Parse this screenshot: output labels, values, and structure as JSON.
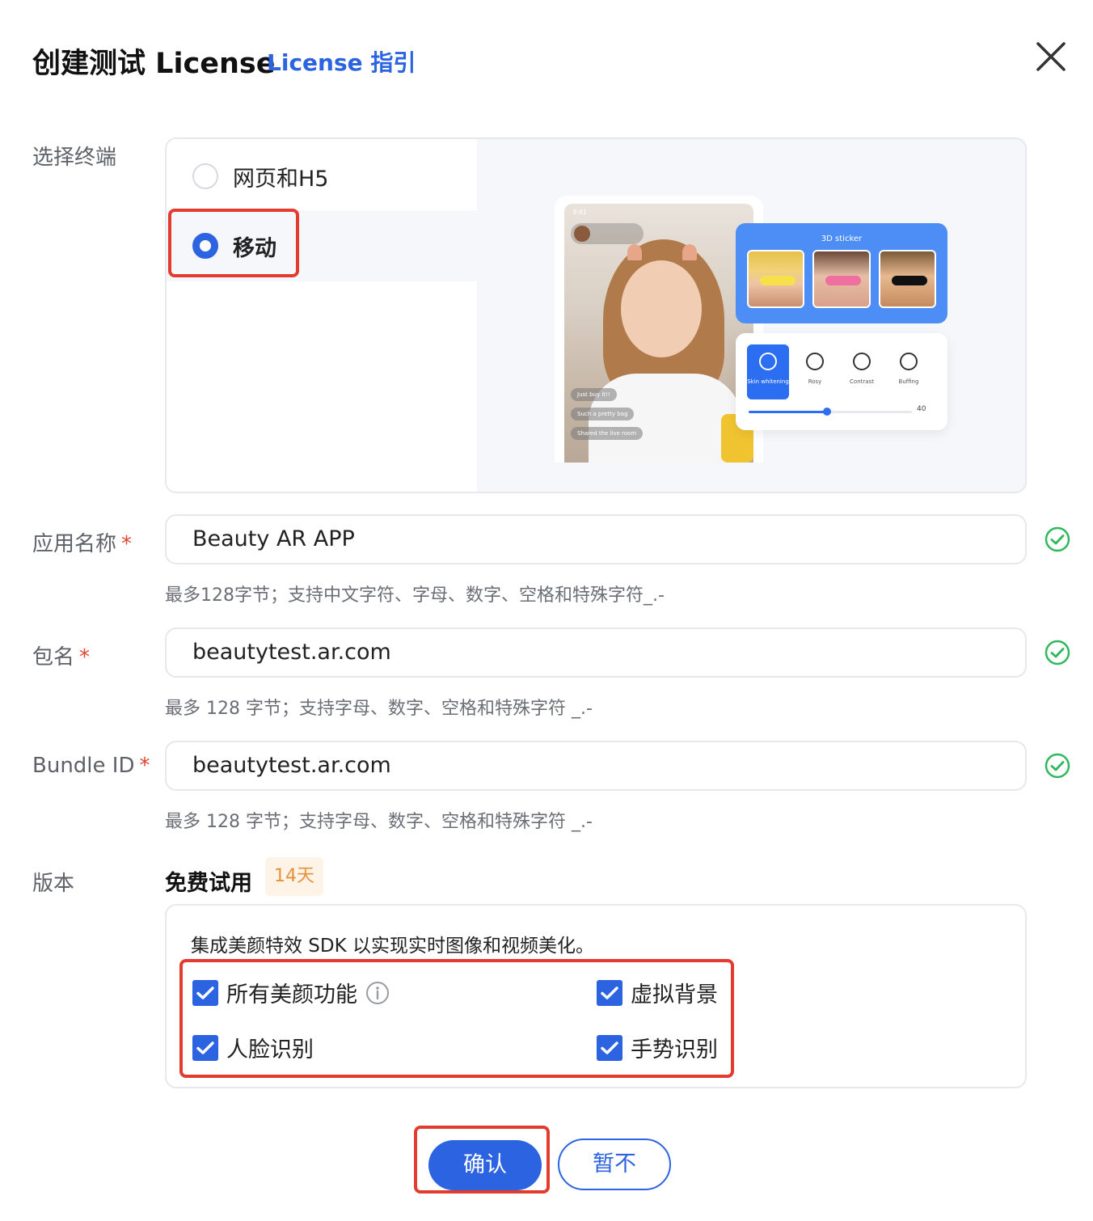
{
  "dialog": {
    "title": "创建测试 License",
    "guide_link": "License 指引"
  },
  "terminal": {
    "label": "选择终端",
    "options": [
      {
        "label": "网页和H5",
        "selected": false
      },
      {
        "label": "移动",
        "selected": true
      }
    ],
    "preview": {
      "phone_time": "9:41",
      "sticker_title": "3D sticker",
      "comments": [
        "Just buy it!!",
        "Such a pretty bag",
        "Shared the live room"
      ],
      "adjust_items": [
        "Skin whitening",
        "Rosy",
        "Contrast",
        "Buffing"
      ],
      "adjust_value": "40",
      "adjust_level_percent": 48
    }
  },
  "app_name": {
    "label": "应用名称",
    "value": "Beauty AR APP",
    "hint": "最多128字节；支持中文字符、字母、数字、空格和特殊字符_.-"
  },
  "package_name": {
    "label": "包名",
    "value": "beautytest.ar.com",
    "hint": "最多 128 字节；支持字母、数字、空格和特殊字符 _.-"
  },
  "bundle_id": {
    "label": "Bundle ID",
    "value": "beautytest.ar.com",
    "hint": "最多 128 字节；支持字母、数字、空格和特殊字符 _.-"
  },
  "required_mark": "*",
  "version": {
    "label": "版本",
    "name": "免费试用",
    "badge": "14天",
    "description": "集成美颜特效 SDK 以实现实时图像和视频美化。",
    "features": [
      {
        "label": "所有美颜功能",
        "checked": true,
        "has_info": true
      },
      {
        "label": "虚拟背景",
        "checked": true
      },
      {
        "label": "人脸识别",
        "checked": true
      },
      {
        "label": "手势识别",
        "checked": true
      }
    ]
  },
  "buttons": {
    "confirm": "确认",
    "cancel": "暂不"
  },
  "colors": {
    "primary": "#2b63e0",
    "highlight": "#e33b2e",
    "success": "#2eb85c",
    "badge_text": "#e8913a"
  }
}
